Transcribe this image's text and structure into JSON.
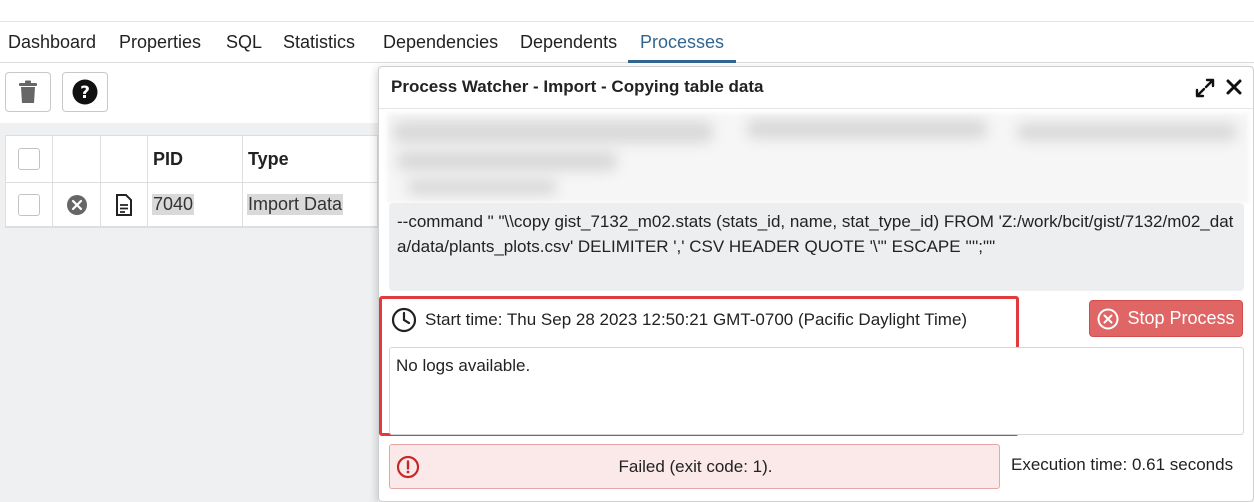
{
  "tabs": [
    {
      "label": "Dashboard"
    },
    {
      "label": "Properties"
    },
    {
      "label": "SQL"
    },
    {
      "label": "Statistics"
    },
    {
      "label": "Dependencies"
    },
    {
      "label": "Dependents"
    },
    {
      "label": "Processes",
      "active": true
    }
  ],
  "toolbar": {
    "delete_icon": "trash-icon",
    "help_icon": "help-icon"
  },
  "grid": {
    "columns": [
      "",
      "",
      "",
      "PID",
      "Type"
    ],
    "rows": [
      {
        "pid": "7040",
        "type": "Import Data",
        "status_icon": "cancel-circle-icon",
        "details_icon": "document-icon"
      }
    ]
  },
  "dialog": {
    "title": "Process Watcher - Import - Copying table data",
    "command": "--command \" \"\\\\copy gist_7132_m02.stats (stats_id, name, stat_type_id) FROM 'Z:/work/bcit/gist/7132/m02_data/data/plants_plots.csv' DELIMITER ',' CSV HEADER QUOTE '\\\"' ESCAPE '''';\"\"",
    "start_time": "Start time: Thu Sep 28 2023 12:50:21 GMT-0700 (Pacific Daylight Time)",
    "logs": "No logs available.",
    "stop_label": "Stop Process",
    "status": "Failed (exit code: 1).",
    "execution_time": "Execution time: 0.61 seconds"
  },
  "colors": {
    "accent": "#326690",
    "highlight_border": "#e0393e",
    "stop_button": "#e06666",
    "fail_bg": "#fbe9e9",
    "fail_icon": "#c62828"
  }
}
